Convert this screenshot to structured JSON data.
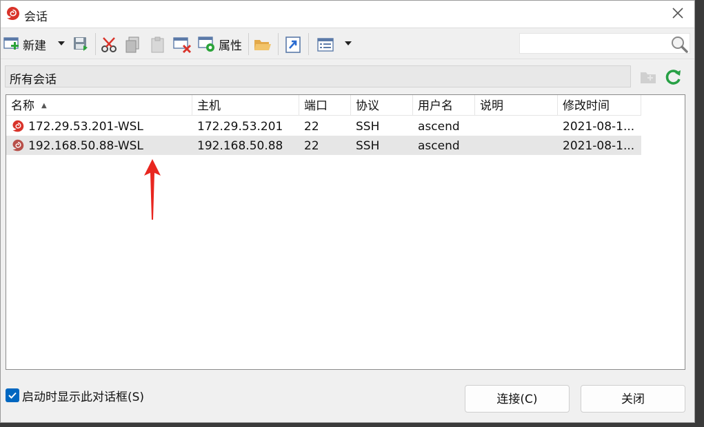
{
  "window": {
    "title": "会话"
  },
  "toolbar": {
    "new_label": "新建",
    "properties_label": "属性",
    "search": {
      "value": "",
      "placeholder": ""
    }
  },
  "pathbar": {
    "text": "所有会话"
  },
  "table": {
    "columns": [
      "名称",
      "主机",
      "端口",
      "协议",
      "用户名",
      "说明",
      "修改时间"
    ],
    "rows": [
      {
        "name": "172.29.53.201-WSL",
        "host": "172.29.53.201",
        "port": "22",
        "protocol": "SSH",
        "user": "ascend",
        "desc": "",
        "modified": "2021-08-1..."
      },
      {
        "name": "192.168.50.88-WSL",
        "host": "192.168.50.88",
        "port": "22",
        "protocol": "SSH",
        "user": "ascend",
        "desc": "",
        "modified": "2021-08-1..."
      }
    ]
  },
  "footer": {
    "show_on_start_label": "启动时显示此对话框(S)",
    "show_on_start_checked": true,
    "connect_label": "连接(C)",
    "close_label": "关闭"
  },
  "colors": {
    "accent": "#0067c0",
    "arrow": "#e8261f",
    "icon_red": "#d9332a"
  }
}
